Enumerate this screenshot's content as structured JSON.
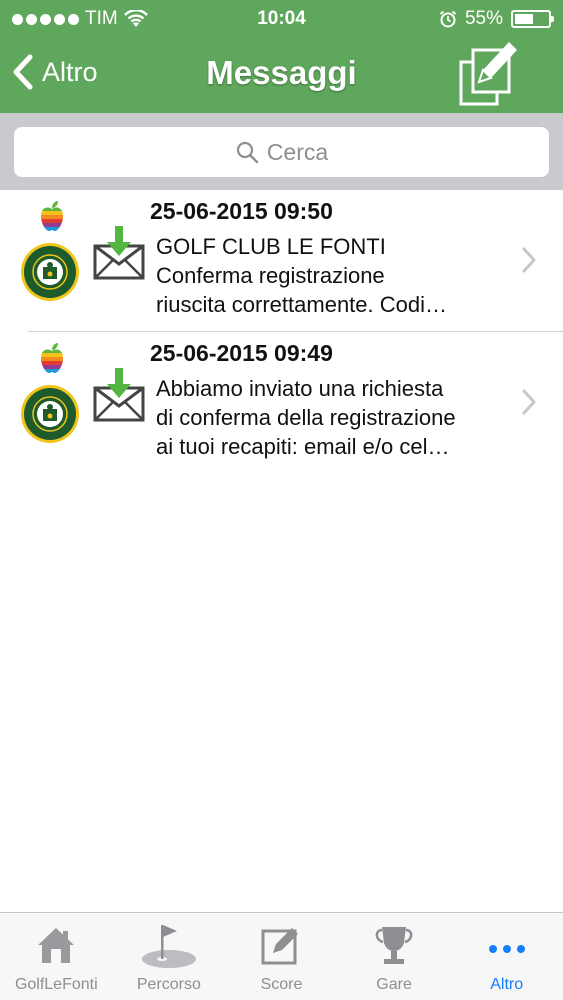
{
  "status_bar": {
    "carrier": "TIM",
    "time": "10:04",
    "battery": "55%",
    "battery_level": 0.55
  },
  "nav": {
    "back_label": "Altro",
    "title": "Messaggi",
    "compose_icon": "compose-icon"
  },
  "search": {
    "placeholder": "Cerca"
  },
  "messages": [
    {
      "datetime": "25-06-2015 09:50",
      "lines": [
        "GOLF CLUB LE FONTI",
        "Conferma registrazione",
        "riuscita correttamente.  Codi…"
      ]
    },
    {
      "datetime": "25-06-2015 09:49",
      "lines": [
        "Abbiamo inviato una richiesta",
        "di conferma della registrazione",
        "ai tuoi recapiti: email e/o cel…"
      ]
    }
  ],
  "tabs": [
    {
      "label": "GolfLeFonti",
      "icon": "home-icon"
    },
    {
      "label": "Percorso",
      "icon": "flag-icon"
    },
    {
      "label": "Score",
      "icon": "pencil-icon"
    },
    {
      "label": "Gare",
      "icon": "trophy-icon"
    },
    {
      "label": "Altro",
      "icon": "more-icon",
      "active": true
    }
  ],
  "colors": {
    "header": "#5fa75c",
    "tab_active": "#157efb",
    "tab_inactive": "#8e8e93",
    "download_arrow": "#53b641"
  }
}
